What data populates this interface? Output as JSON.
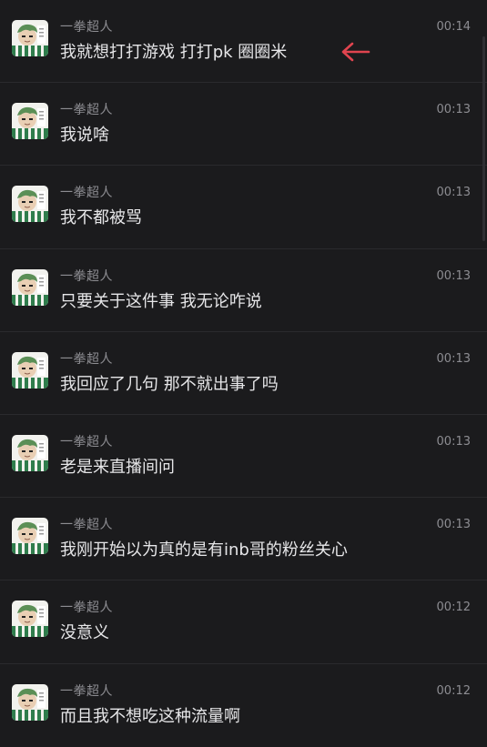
{
  "messages": [
    {
      "sender": "一拳超人",
      "time": "00:14",
      "text": "我就想打打游戏 打打pk 圈圈米"
    },
    {
      "sender": "一拳超人",
      "time": "00:13",
      "text": "我说啥"
    },
    {
      "sender": "一拳超人",
      "time": "00:13",
      "text": "我不都被骂"
    },
    {
      "sender": "一拳超人",
      "time": "00:13",
      "text": "只要关于这件事  我无论咋说"
    },
    {
      "sender": "一拳超人",
      "time": "00:13",
      "text": "我回应了几句 那不就出事了吗"
    },
    {
      "sender": "一拳超人",
      "time": "00:13",
      "text": "老是来直播间问"
    },
    {
      "sender": "一拳超人",
      "time": "00:13",
      "text": "我刚开始以为真的是有inb哥的粉丝关心"
    },
    {
      "sender": "一拳超人",
      "time": "00:12",
      "text": "没意义"
    },
    {
      "sender": "一拳超人",
      "time": "00:12",
      "text": "而且我不想吃这种流量啊"
    }
  ],
  "annotation": {
    "icon": "arrow-left-icon",
    "color": "#e0444f"
  },
  "colors": {
    "background": "#1b1b1d",
    "divider": "#2a2a2d",
    "name": "#8d8d92",
    "text": "#e6e6e8"
  }
}
